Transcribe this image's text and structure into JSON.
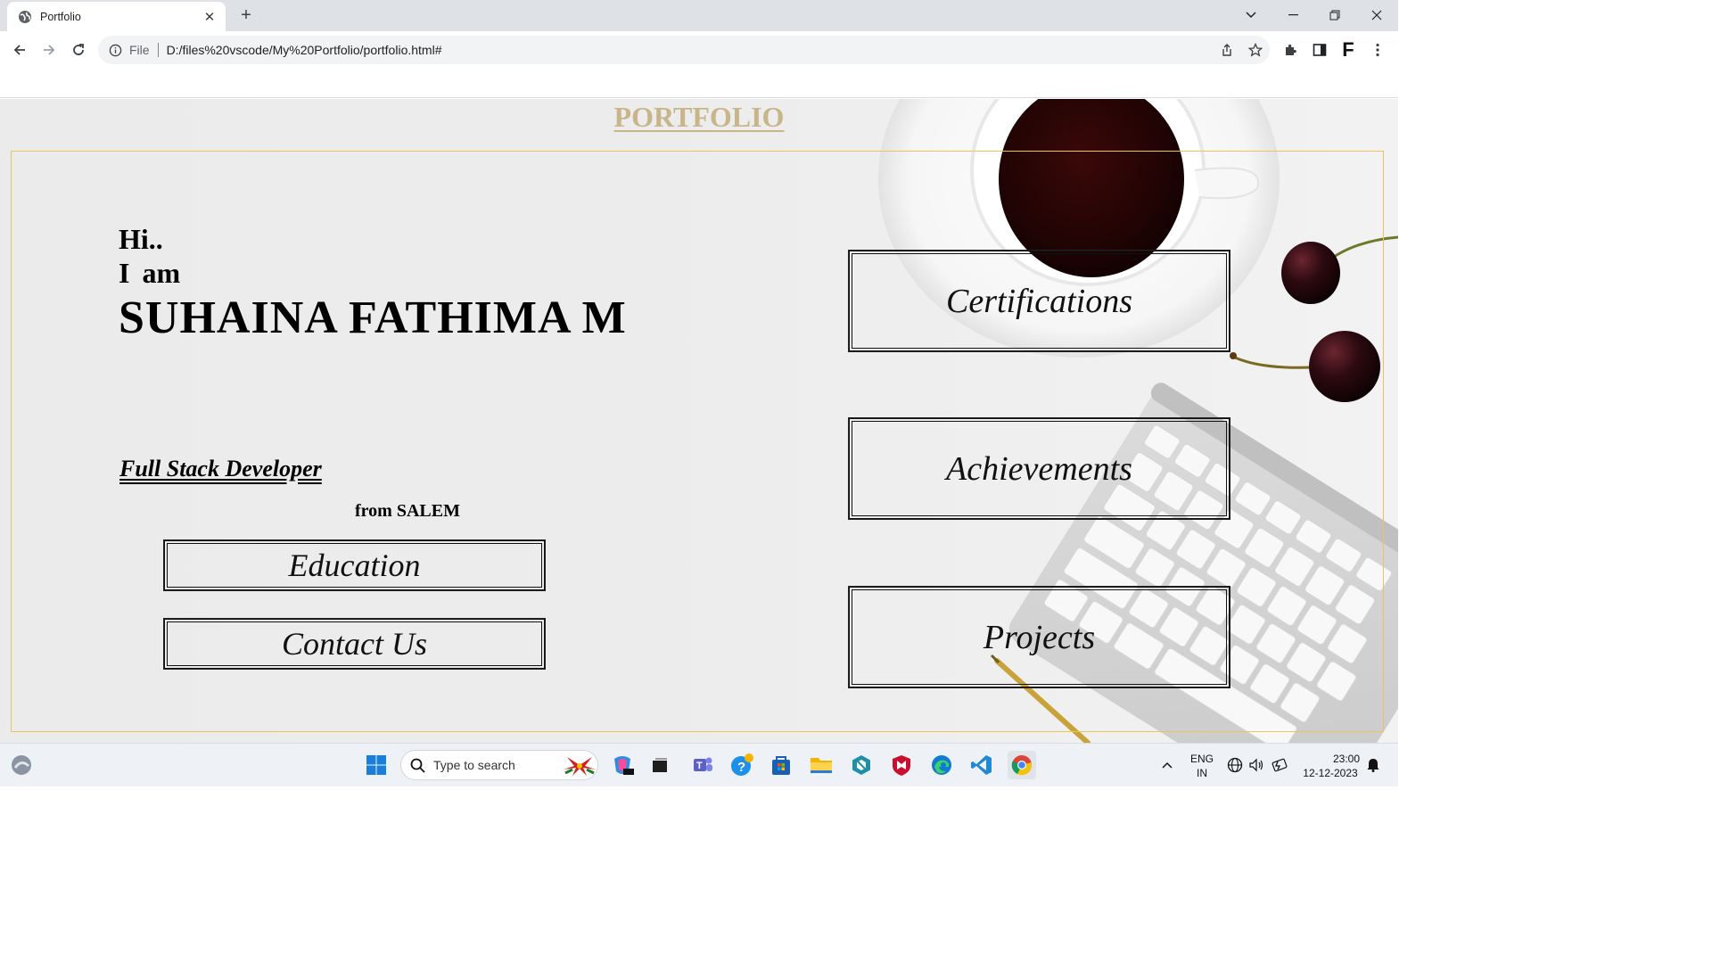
{
  "browser": {
    "tab_title": "Portfolio",
    "address_scheme": "File",
    "url": "D:/files%20vscode/My%20Portfolio/portfolio.html#",
    "profile_initial": "F"
  },
  "page": {
    "title": "PORTFOLIO",
    "greeting": "Hi..",
    "intro": "I am",
    "name": "SUHAINA FATHIMA M",
    "role": "Full Stack Developer",
    "location": "from SALEM",
    "left_buttons": [
      "Education",
      "Contact Us"
    ],
    "right_buttons": [
      "Certifications",
      "Achievements",
      "Projects"
    ]
  },
  "taskbar": {
    "search_placeholder": "Type to search",
    "language_line1": "ENG",
    "language_line2": "IN",
    "time": "23:00",
    "date": "12-12-2023"
  },
  "colors": {
    "title": "#c8b58a",
    "frame_border": "#f0c35a"
  }
}
